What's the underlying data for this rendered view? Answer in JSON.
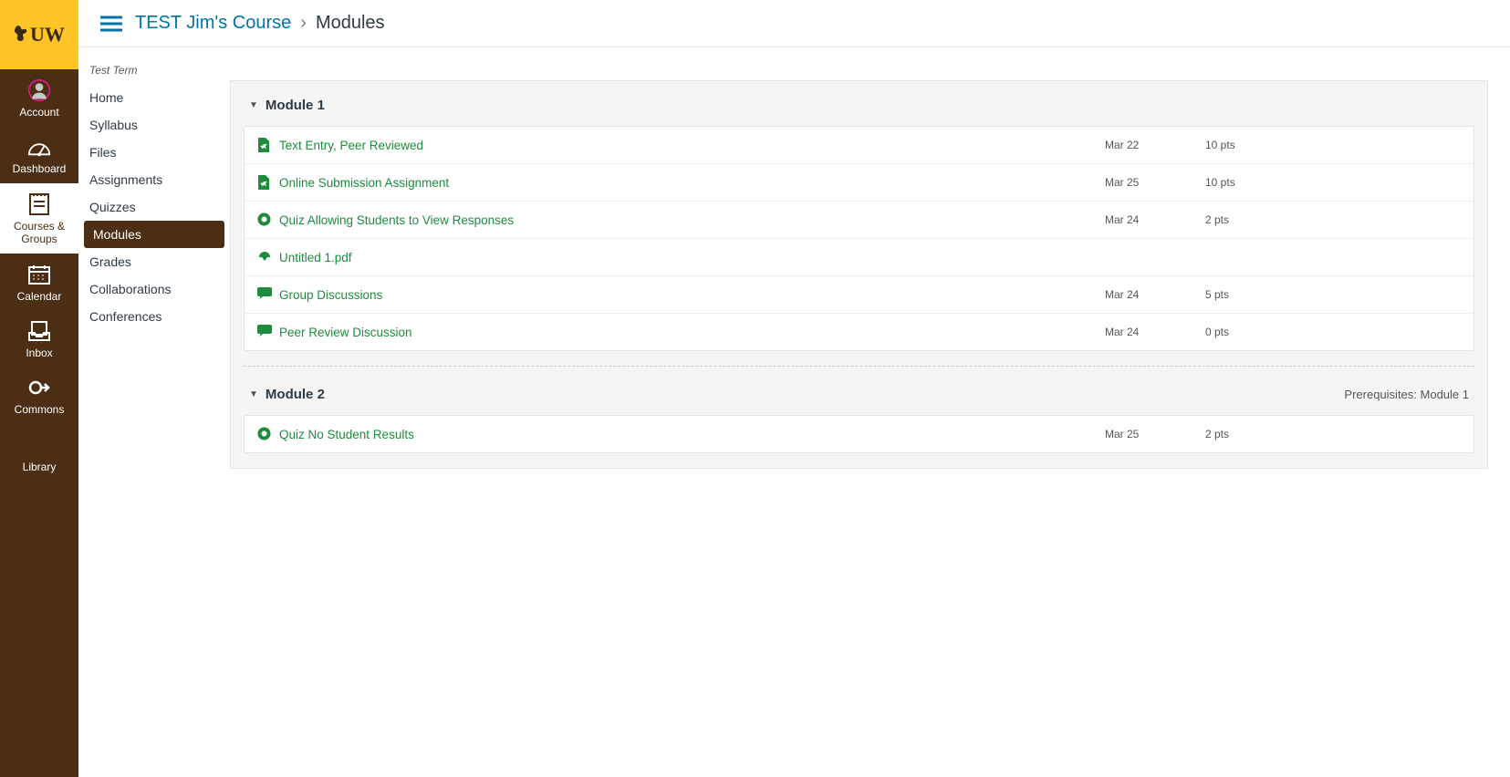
{
  "logo": "UW",
  "globalNav": [
    {
      "id": "account",
      "label": "Account"
    },
    {
      "id": "dashboard",
      "label": "Dashboard"
    },
    {
      "id": "courses",
      "label": "Courses &\nGroups",
      "active": true
    },
    {
      "id": "calendar",
      "label": "Calendar"
    },
    {
      "id": "inbox",
      "label": "Inbox"
    },
    {
      "id": "commons",
      "label": "Commons"
    },
    {
      "id": "library",
      "label": "Library"
    }
  ],
  "breadcrumb": {
    "course": "TEST Jim's Course",
    "sep": "›",
    "page": "Modules"
  },
  "term": "Test Term",
  "courseNav": [
    {
      "label": "Home"
    },
    {
      "label": "Syllabus"
    },
    {
      "label": "Files"
    },
    {
      "label": "Assignments"
    },
    {
      "label": "Quizzes"
    },
    {
      "label": "Modules",
      "active": true
    },
    {
      "label": "Grades"
    },
    {
      "label": "Collaborations"
    },
    {
      "label": "Conferences"
    }
  ],
  "modules": [
    {
      "title": "Module 1",
      "prereq": "",
      "items": [
        {
          "icon": "assignment",
          "title": "Text Entry, Peer Reviewed",
          "due": "Mar 22",
          "pts": "10 pts"
        },
        {
          "icon": "assignment",
          "title": "Online Submission Assignment",
          "due": "Mar 25",
          "pts": "10 pts"
        },
        {
          "icon": "quiz",
          "title": "Quiz Allowing Students to View Responses",
          "due": "Mar 24",
          "pts": "2 pts"
        },
        {
          "icon": "file",
          "title": "Untitled 1.pdf",
          "due": "",
          "pts": ""
        },
        {
          "icon": "discussion",
          "title": "Group Discussions",
          "due": "Mar 24",
          "pts": "5 pts"
        },
        {
          "icon": "discussion",
          "title": "Peer Review Discussion",
          "due": "Mar 24",
          "pts": "0 pts"
        }
      ]
    },
    {
      "title": "Module 2",
      "prereq": "Prerequisites: Module 1",
      "items": [
        {
          "icon": "quiz",
          "title": "Quiz No Student Results",
          "due": "Mar 25",
          "pts": "2 pts"
        }
      ]
    }
  ]
}
